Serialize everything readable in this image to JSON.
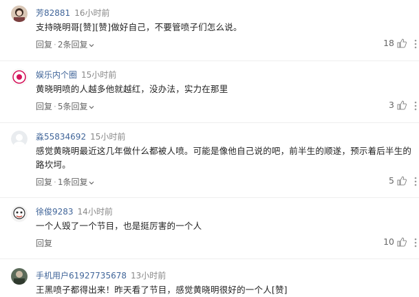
{
  "comments": [
    {
      "user": "芳82881",
      "time": "16小时前",
      "text": "支持晓明哥[赞][赞]做好自己，不要管喷子们怎么说。",
      "reply_label": "回复",
      "replies_label": "2条回复",
      "likes": "18"
    },
    {
      "user": "娱乐内个圈",
      "time": "15小时前",
      "text": "黄晓明喷的人越多他就越红，没办法，实力在那里",
      "reply_label": "回复",
      "replies_label": "5条回复",
      "likes": "3"
    },
    {
      "user": "淼55834692",
      "time": "15小时前",
      "text": "感觉黄晓明最近这几年做什么都被人喷。可能是像他自己说的吧，前半生的顺遂，预示着后半生的路坎坷。",
      "reply_label": "回复",
      "replies_label": "1条回复",
      "likes": "5"
    },
    {
      "user": "徐俊9283",
      "time": "14小时前",
      "text": "一个人毁了一个节目，也是挺厉害的一个人",
      "reply_label": "回复",
      "replies_label": "",
      "likes": "10"
    },
    {
      "user": "手机用户61927735678",
      "time": "13小时前",
      "text": "王黑喷子都得出来！昨天看了节目，感觉黄晓明很好的一个人[赞]",
      "reply_label": "",
      "replies_label": "",
      "likes": ""
    }
  ],
  "icons": {
    "like": "thumb-up-icon",
    "more": "more-vertical-icon",
    "expand": "chevron-down-icon"
  },
  "colors": {
    "username": "#406599",
    "meta": "#888888",
    "text": "#222222"
  }
}
